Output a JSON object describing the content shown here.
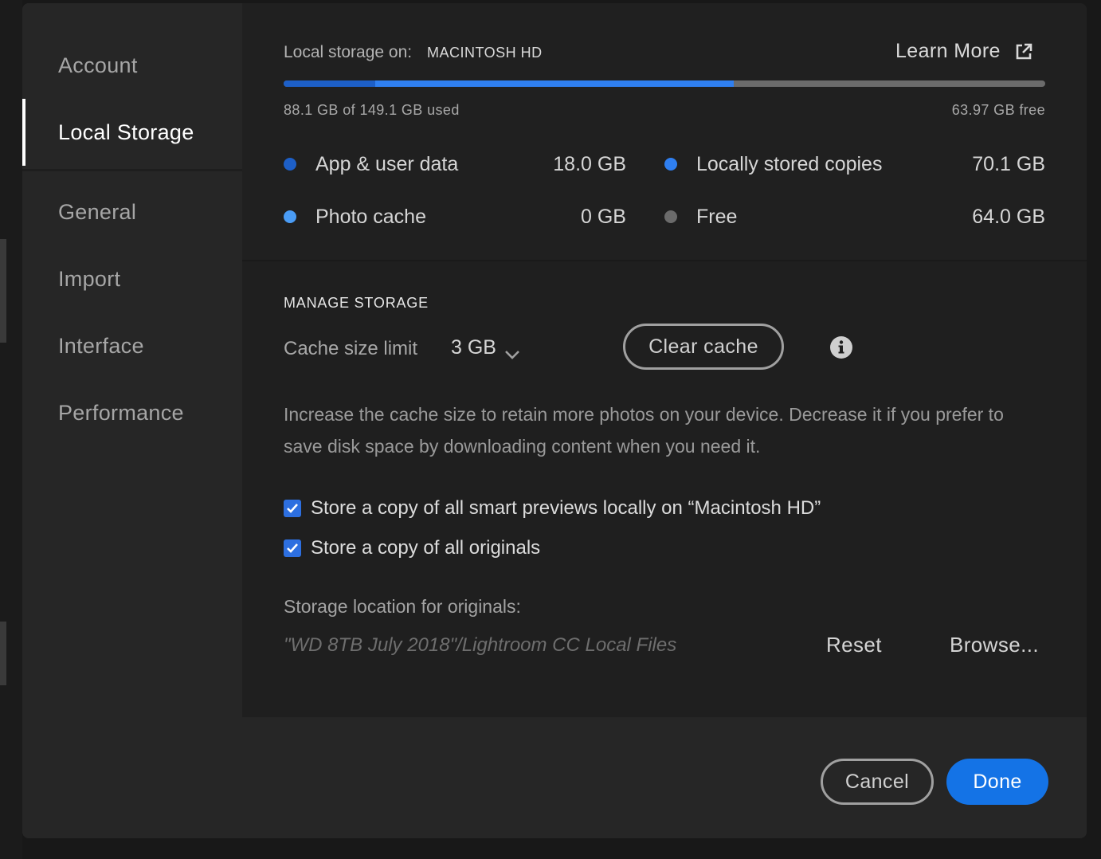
{
  "sidebar": {
    "items": [
      {
        "label": "Account"
      },
      {
        "label": "Local Storage"
      },
      {
        "label": "General"
      },
      {
        "label": "Import"
      },
      {
        "label": "Interface"
      },
      {
        "label": "Performance"
      }
    ],
    "active": "Local Storage"
  },
  "storage": {
    "label": "Local storage on:",
    "disk": "MACINTOSH HD",
    "learn_more": "Learn More",
    "used_text": "88.1 GB of 149.1 GB used",
    "free_text": "63.97 GB free",
    "bar": {
      "total_gb": 149.1,
      "segments": [
        {
          "name": "App & user data",
          "gb": 18.0,
          "color": "#1d5fc7"
        },
        {
          "name": "Locally stored copies",
          "gb": 70.1,
          "color": "#2f7ff0"
        }
      ],
      "free_color": "#6b6b6b"
    },
    "legend": [
      {
        "label": "App & user data",
        "value": "18.0 GB",
        "color": "#1d5fc7"
      },
      {
        "label": "Locally stored copies",
        "value": "70.1 GB",
        "color": "#2f7ff0"
      },
      {
        "label": "Photo cache",
        "value": "0 GB",
        "color": "#4a9cf5"
      },
      {
        "label": "Free",
        "value": "64.0 GB",
        "color": "#6b6b6b"
      }
    ]
  },
  "manage": {
    "title": "MANAGE STORAGE",
    "cache_label": "Cache size limit",
    "cache_value": "3 GB",
    "clear_cache": "Clear cache",
    "description": "Increase the cache size to retain more photos on your device. Decrease it if you prefer to save disk space by downloading content when you need it.",
    "checkboxes": [
      {
        "label": "Store a copy of all smart previews locally on “Macintosh HD”",
        "checked": true
      },
      {
        "label": "Store a copy of all originals",
        "checked": true
      }
    ],
    "location_label": "Storage location for originals:",
    "location_path": "\"WD 8TB July 2018\"/Lightroom CC Local Files",
    "reset": "Reset",
    "browse": "Browse..."
  },
  "footer": {
    "cancel": "Cancel",
    "done": "Done"
  },
  "colors": {
    "accent": "#1473e6",
    "checkbox": "#2d6fe0"
  }
}
